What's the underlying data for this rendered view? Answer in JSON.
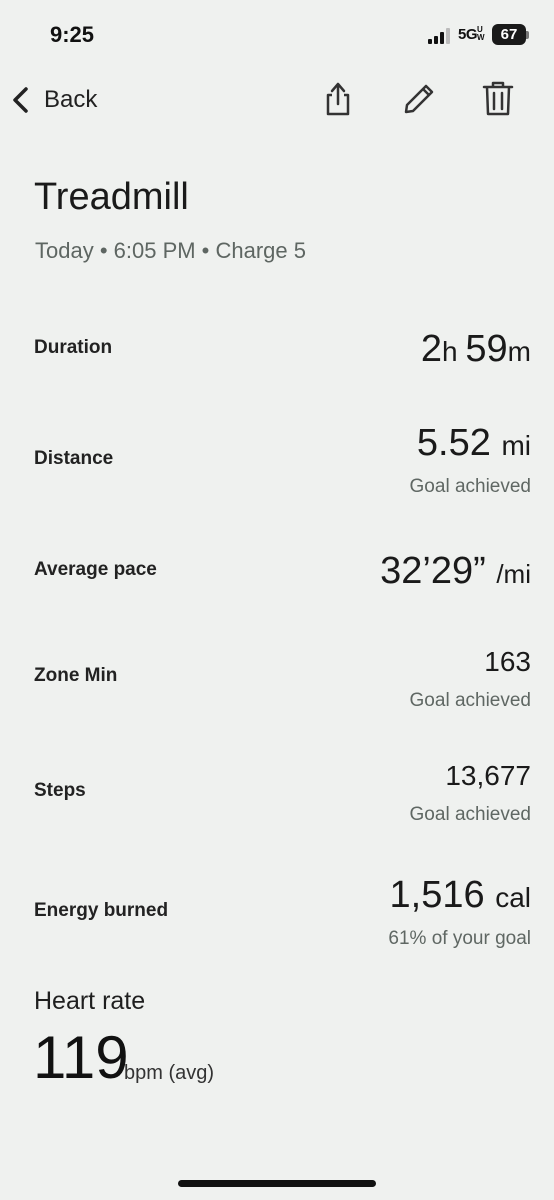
{
  "status_bar": {
    "time": "9:25",
    "network": "5G",
    "network_sub": "UW",
    "battery": "67"
  },
  "nav": {
    "back_label": "Back",
    "icons": [
      "share-icon",
      "edit-icon",
      "trash-icon"
    ]
  },
  "header": {
    "title": "Treadmill",
    "subtitle": "Today • 6:05 PM • Charge 5"
  },
  "stats": [
    {
      "label": "Duration",
      "value_parts": [
        "2",
        "h ",
        "59",
        "m"
      ],
      "sub": ""
    },
    {
      "label": "Distance",
      "value": "5.52",
      "unit": "mi",
      "sub": "Goal achieved"
    },
    {
      "label": "Average pace",
      "value": "32’29”",
      "unit": "/mi",
      "sub": ""
    },
    {
      "label": "Zone Min",
      "value": "163",
      "sub": "Goal achieved"
    },
    {
      "label": "Steps",
      "value": "13,677",
      "sub": "Goal achieved"
    },
    {
      "label": "Energy burned",
      "value": "1,516",
      "unit": "cal",
      "sub": "61% of your goal"
    }
  ],
  "heart_rate": {
    "title": "Heart rate",
    "value": "119",
    "unit": "bpm (avg)"
  },
  "colors": {
    "background": "#eff1ef",
    "secondary_text": "#5e6662"
  }
}
